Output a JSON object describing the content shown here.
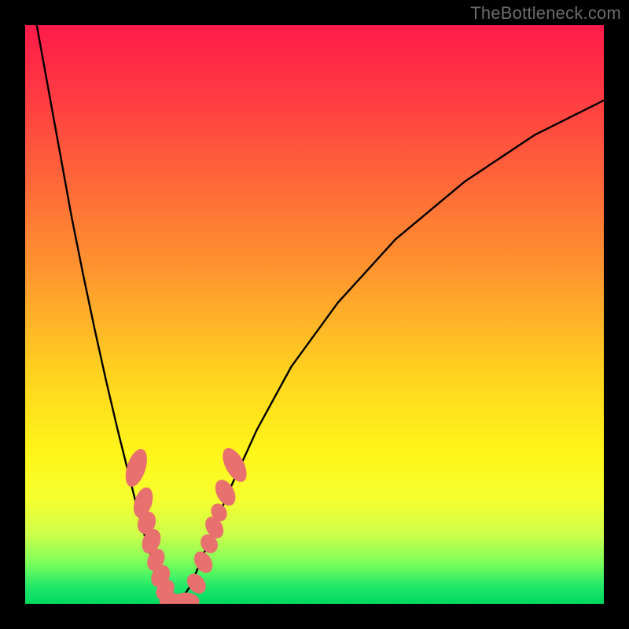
{
  "watermark": {
    "text": "TheBottleneck.com"
  },
  "chart_data": {
    "type": "line",
    "title": "",
    "xlabel": "",
    "ylabel": "",
    "xlim": [
      0,
      100
    ],
    "ylim": [
      0,
      100
    ],
    "series": [
      {
        "name": "curve-left",
        "x": [
          2,
          4,
          6,
          8,
          10,
          12,
          14,
          16,
          18,
          19.5,
          21,
          22.5,
          24,
          25,
          26
        ],
        "y": [
          100,
          89,
          78,
          67,
          57,
          47.5,
          38.5,
          30,
          22,
          16,
          10.5,
          6,
          2.5,
          0.8,
          0
        ]
      },
      {
        "name": "curve-right",
        "x": [
          26,
          27,
          28.5,
          30,
          32,
          35,
          40,
          46,
          54,
          64,
          76,
          88,
          100
        ],
        "y": [
          0,
          0.8,
          3,
          6.5,
          11.5,
          19,
          30,
          41,
          52,
          63,
          73,
          81,
          87
        ]
      }
    ],
    "markers": {
      "name": "dots",
      "color": "#e8706e",
      "points": [
        {
          "x": 19.2,
          "y": 23.5,
          "rx": 1.6,
          "ry": 3.4,
          "rot": 18
        },
        {
          "x": 20.4,
          "y": 17.5,
          "rx": 1.5,
          "ry": 2.7,
          "rot": 18
        },
        {
          "x": 21.0,
          "y": 14.0,
          "rx": 1.5,
          "ry": 2.0,
          "rot": 20
        },
        {
          "x": 21.8,
          "y": 10.8,
          "rx": 1.5,
          "ry": 2.2,
          "rot": 22
        },
        {
          "x": 22.6,
          "y": 7.6,
          "rx": 1.4,
          "ry": 2.0,
          "rot": 24
        },
        {
          "x": 23.4,
          "y": 4.8,
          "rx": 1.5,
          "ry": 2.0,
          "rot": 28
        },
        {
          "x": 24.2,
          "y": 2.4,
          "rx": 1.4,
          "ry": 1.9,
          "rot": 35
        },
        {
          "x": 25.2,
          "y": 0.45,
          "rx": 2.0,
          "ry": 1.5,
          "rot": 0
        },
        {
          "x": 27.8,
          "y": 0.45,
          "rx": 2.3,
          "ry": 1.5,
          "rot": 0
        },
        {
          "x": 29.6,
          "y": 3.5,
          "rx": 1.4,
          "ry": 1.9,
          "rot": -40
        },
        {
          "x": 30.8,
          "y": 7.2,
          "rx": 1.4,
          "ry": 2.0,
          "rot": -32
        },
        {
          "x": 31.8,
          "y": 10.4,
          "rx": 1.4,
          "ry": 1.7,
          "rot": -30
        },
        {
          "x": 32.7,
          "y": 13.2,
          "rx": 1.4,
          "ry": 2.0,
          "rot": -30
        },
        {
          "x": 33.5,
          "y": 15.8,
          "rx": 1.3,
          "ry": 1.6,
          "rot": -30
        },
        {
          "x": 34.6,
          "y": 19.2,
          "rx": 1.5,
          "ry": 2.4,
          "rot": -28
        },
        {
          "x": 36.2,
          "y": 24.0,
          "rx": 1.6,
          "ry": 3.2,
          "rot": -28
        }
      ]
    }
  }
}
